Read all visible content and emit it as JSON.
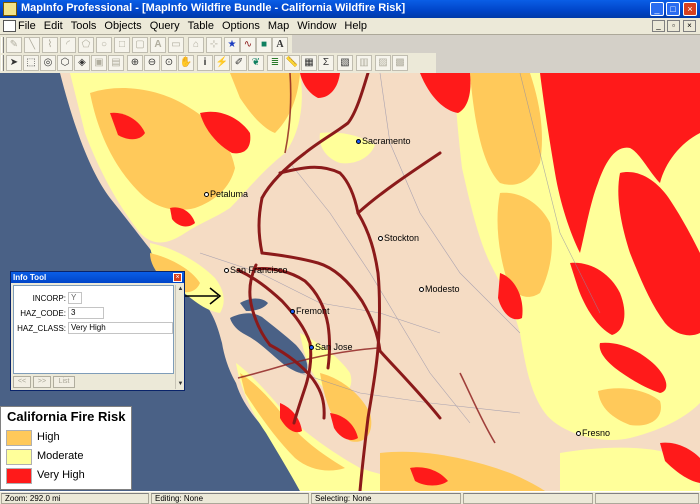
{
  "window": {
    "title": "MapInfo Professional - [MapInfo Wildfire Bundle - California Wildfire Risk]"
  },
  "menubar": {
    "items": [
      "File",
      "Edit",
      "Tools",
      "Objects",
      "Query",
      "Table",
      "Options",
      "Map",
      "Window",
      "Help"
    ]
  },
  "toolbar1": {
    "icons": [
      "pencil-icon",
      "line-icon",
      "polyline-icon",
      "arc-icon",
      "polygon-icon",
      "ellipse-icon",
      "rectangle-icon",
      "rounded-rect-icon",
      "text-icon",
      "frame-icon",
      "reshape-icon",
      "add-node-icon",
      "symbol-style-icon",
      "line-style-icon",
      "region-style-icon",
      "text-style-icon"
    ]
  },
  "toolbar2": {
    "icons": [
      "select-arrow-icon",
      "marquee-select-icon",
      "radius-select-icon",
      "polygon-select-icon",
      "boundary-select-icon",
      "unselect-icon",
      "invert-select-icon",
      "zoom-in-icon",
      "zoom-out-icon",
      "change-view-icon",
      "grabber-icon",
      "info-tool-icon",
      "hotlink-icon",
      "label-tool-icon",
      "drag-window-icon",
      "layer-control-icon",
      "ruler-icon",
      "legend-icon",
      "statistics-icon",
      "clip-region-icon",
      "create-legend-icon",
      "graph-icon",
      "3d-map-icon"
    ]
  },
  "map": {
    "cities": [
      {
        "name": "Sacramento",
        "style": "blue"
      },
      {
        "name": "Petaluma",
        "style": "plain"
      },
      {
        "name": "Stockton",
        "style": "plain"
      },
      {
        "name": "San Francisco",
        "style": "plain"
      },
      {
        "name": "Modesto",
        "style": "plain"
      },
      {
        "name": "Fremont",
        "style": "blue"
      },
      {
        "name": "San Jose",
        "style": "blue"
      },
      {
        "name": "Fresno",
        "style": "plain"
      }
    ],
    "colors": {
      "ocean": "#4a6186",
      "land_low": "#f5dcc4",
      "high": "#ffc95a",
      "moderate": "#ffff9a",
      "very_high": "#ff1a1a",
      "highway": "#8b1a1a"
    }
  },
  "info_tool": {
    "title": "Info Tool",
    "fields": [
      {
        "label": "INCORP:",
        "value": "Y"
      },
      {
        "label": "HAZ_CODE:",
        "value": "3"
      },
      {
        "label": "HAZ_CLASS:",
        "value": "Very High"
      }
    ],
    "buttons": [
      "<<",
      ">>",
      "List"
    ]
  },
  "legend": {
    "title": "California Fire Risk",
    "items": [
      {
        "label": "High",
        "color": "#ffc95a"
      },
      {
        "label": "Moderate",
        "color": "#ffff9a"
      },
      {
        "label": "Very High",
        "color": "#ff1a1a"
      }
    ]
  },
  "status": {
    "zoom": "Zoom: 292.0 mi",
    "editing": "Editing: None",
    "selecting": "Selecting: None"
  }
}
